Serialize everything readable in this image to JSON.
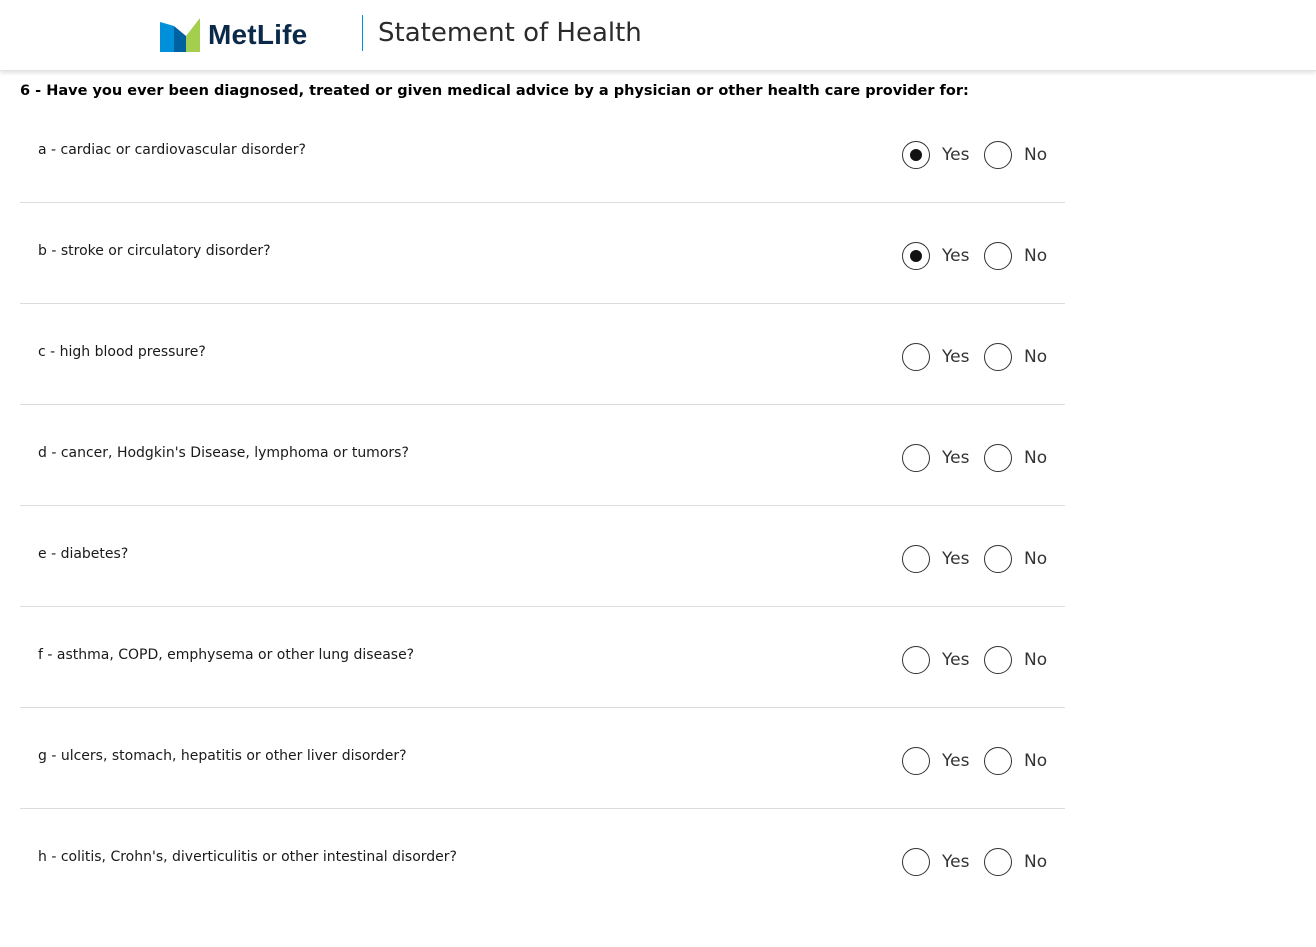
{
  "header": {
    "brand": "MetLife",
    "title": "Statement of Health",
    "logo_colors": [
      "#0090da",
      "#a4ce4e"
    ]
  },
  "question": {
    "heading": "6 - Have you ever been diagnosed, treated or given medical advice by a physician or other health care provider for:",
    "yes_label": "Yes",
    "no_label": "No",
    "items": [
      {
        "label": "a - cardiac or cardiovascular disorder?",
        "answer": "yes"
      },
      {
        "label": "b - stroke or circulatory disorder?",
        "answer": "yes"
      },
      {
        "label": "c - high blood pressure?",
        "answer": ""
      },
      {
        "label": "d - cancer, Hodgkin's Disease, lymphoma or tumors?",
        "answer": ""
      },
      {
        "label": "e - diabetes?",
        "answer": ""
      },
      {
        "label": "f - asthma, COPD, emphysema or other lung disease?",
        "answer": ""
      },
      {
        "label": "g - ulcers, stomach, hepatitis or other liver disorder?",
        "answer": ""
      },
      {
        "label": "h - colitis, Crohn's, diverticulitis or other intestinal disorder?",
        "answer": ""
      }
    ]
  }
}
